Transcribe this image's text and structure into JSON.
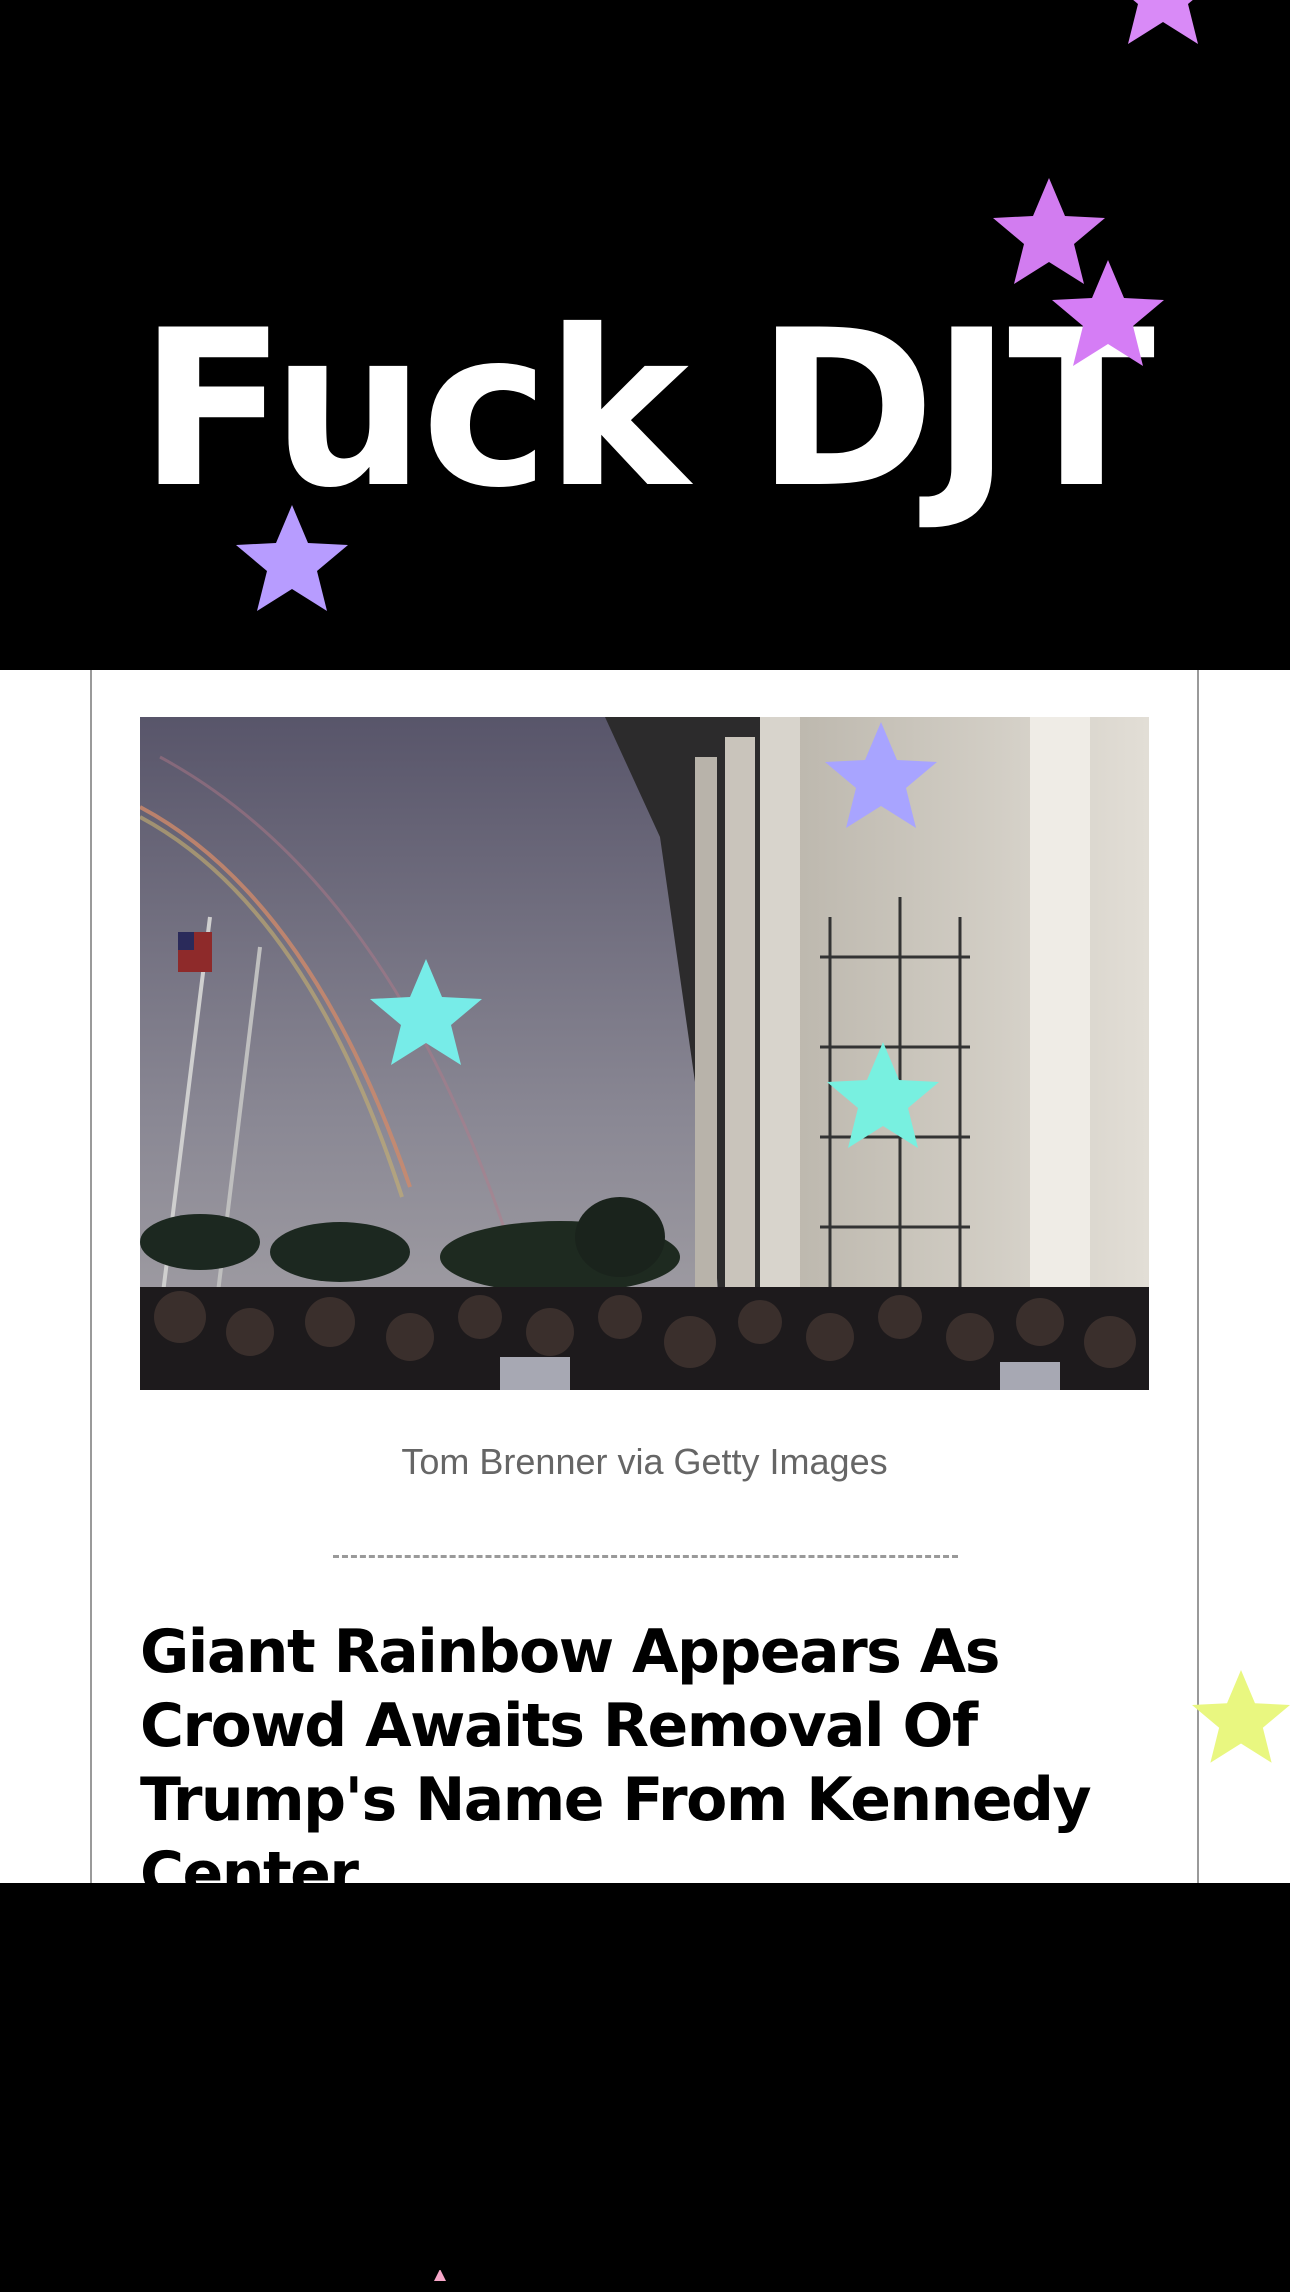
{
  "banner": {
    "text": "Fuck DJT"
  },
  "article": {
    "image_caption": "Tom Brenner via Getty Images",
    "title": "Giant Rainbow Appears As Crowd Awaits Removal Of Trump's Name From Kennedy Center"
  },
  "decorations": {
    "stars": [
      {
        "name": "star-icon",
        "color": "#d27cf0"
      },
      {
        "name": "star-icon",
        "color": "#d57df5"
      },
      {
        "name": "star-icon",
        "color": "#d98af7"
      },
      {
        "name": "star-icon",
        "color": "#b79cff"
      },
      {
        "name": "star-icon",
        "color": "#a8a4ff"
      },
      {
        "name": "star-icon",
        "color": "#77ece8"
      },
      {
        "name": "star-icon",
        "color": "#78f0e0"
      },
      {
        "name": "star-icon",
        "color": "#e9f780"
      },
      {
        "name": "star-icon",
        "color": "#f6a6c8"
      }
    ]
  }
}
